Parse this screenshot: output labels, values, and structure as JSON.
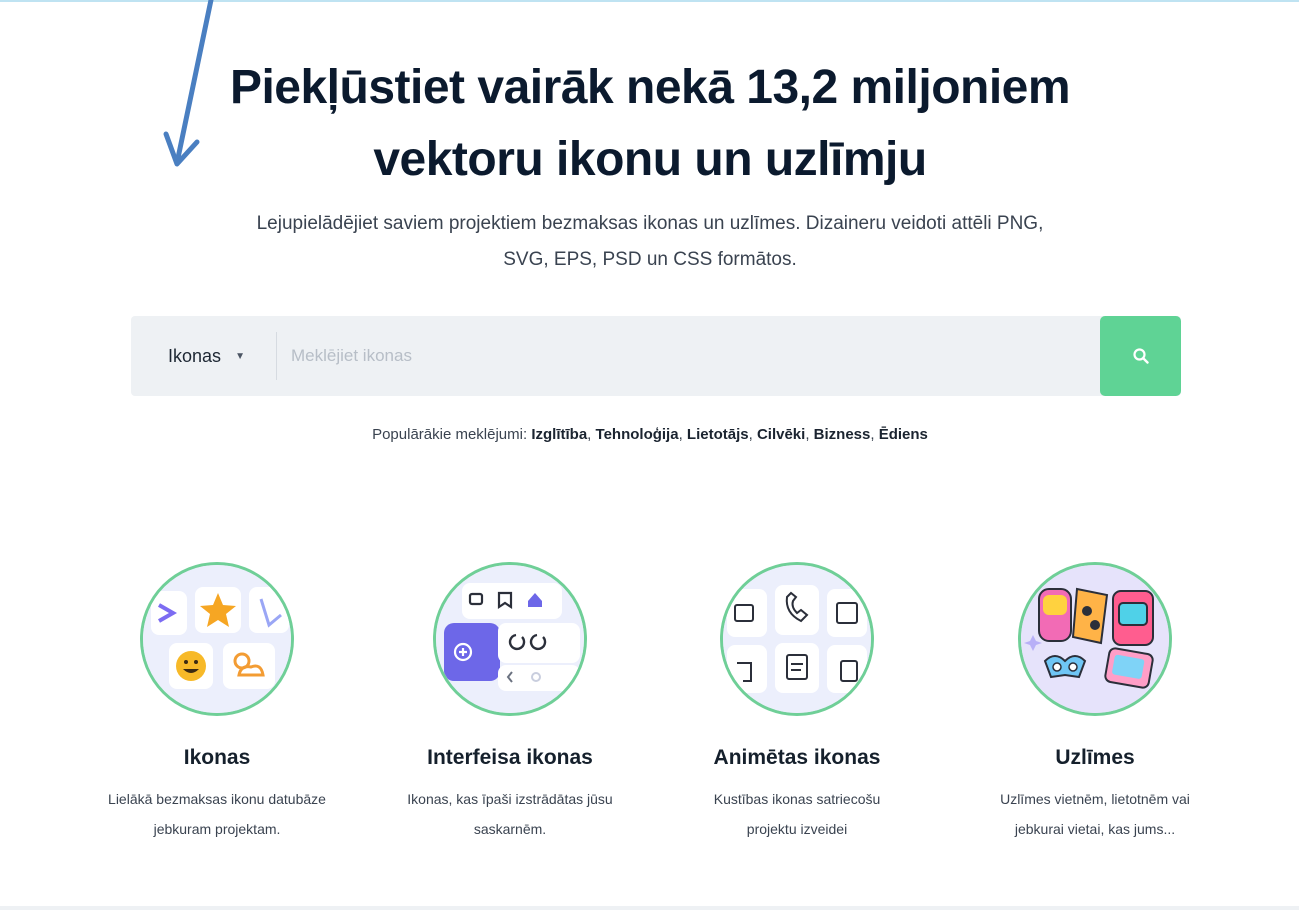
{
  "hero": {
    "title_line1": "Piekļūstiet vairāk nekā 13,2 miljoniem",
    "title_line2": "vektoru ikonu un uzlīmju",
    "subtitle_line1": "Lejupielādējiet saviem projektiem bezmaksas ikonas un uzlīmes. Dizaineru veidoti attēli PNG,",
    "subtitle_line2": "SVG, EPS, PSD un CSS formātos."
  },
  "search": {
    "type_label": "Ikonas",
    "placeholder": "Meklējiet ikonas",
    "button_icon": "search-icon"
  },
  "popular": {
    "label": "Populārākie meklējumi:",
    "terms": [
      "Izglītība",
      "Tehnoloģija",
      "Lietotājs",
      "Cilvēki",
      "Bizness",
      "Ēdiens"
    ]
  },
  "categories": [
    {
      "title": "Ikonas",
      "desc_line1": "Lielākā bezmaksas ikonu datubāze",
      "desc_line2": "jebkuram projektam."
    },
    {
      "title": "Interfeisa ikonas",
      "desc_line1": "Ikonas, kas īpaši izstrādātas jūsu",
      "desc_line2": "saskarnēm."
    },
    {
      "title": "Animētas ikonas",
      "desc_line1": "Kustības ikonas satriecošu",
      "desc_line2": "projektu izveidei"
    },
    {
      "title": "Uzlīmes",
      "desc_line1": "Uzlīmes vietnēm, lietotnēm vai",
      "desc_line2": "jebkurai vietai, kas jums..."
    }
  ],
  "colors": {
    "accent_green": "#5fd395",
    "circle_border": "#6fcf97",
    "arrow_blue": "#4a7fc1",
    "heading_dark": "#0b1a2e"
  }
}
